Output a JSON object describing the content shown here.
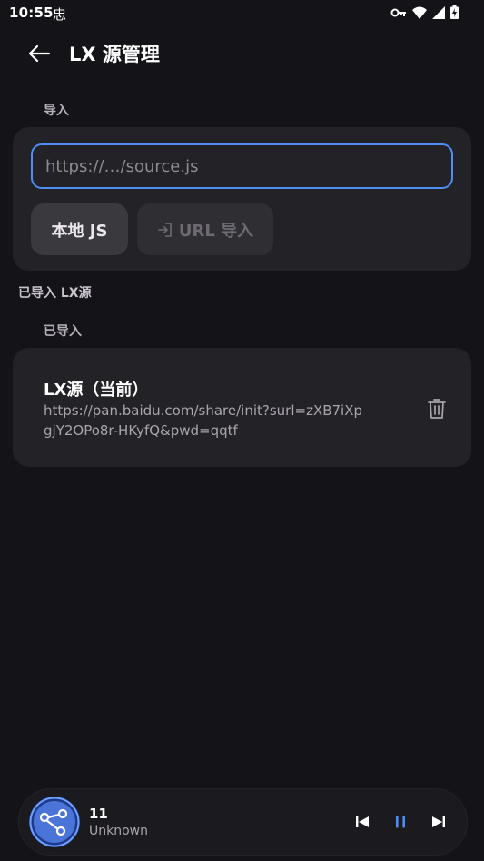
{
  "status_bar": {
    "time": "10:55",
    "notification_glyph": "忠"
  },
  "header": {
    "title": "LX 源管理",
    "back_icon": "arrow-left-icon"
  },
  "import_section": {
    "label": "导入",
    "url_placeholder": "https://…/source.js",
    "url_value": "",
    "local_button": "本地 JS",
    "url_button": "URL 导入"
  },
  "imported_header": "已导入 LX源",
  "imported_section": {
    "label": "已导入",
    "items": [
      {
        "name": "LX源（当前）",
        "url": "https://pan.baidu.com/share/init?surl=zXB7iXpgjY2OPo8r-HKyfQ&pwd=qqtf"
      }
    ]
  },
  "player": {
    "title": "11",
    "artist": "Unknown"
  },
  "colors": {
    "accent": "#4F8EF7",
    "background": "#141317",
    "card": "#232226"
  }
}
